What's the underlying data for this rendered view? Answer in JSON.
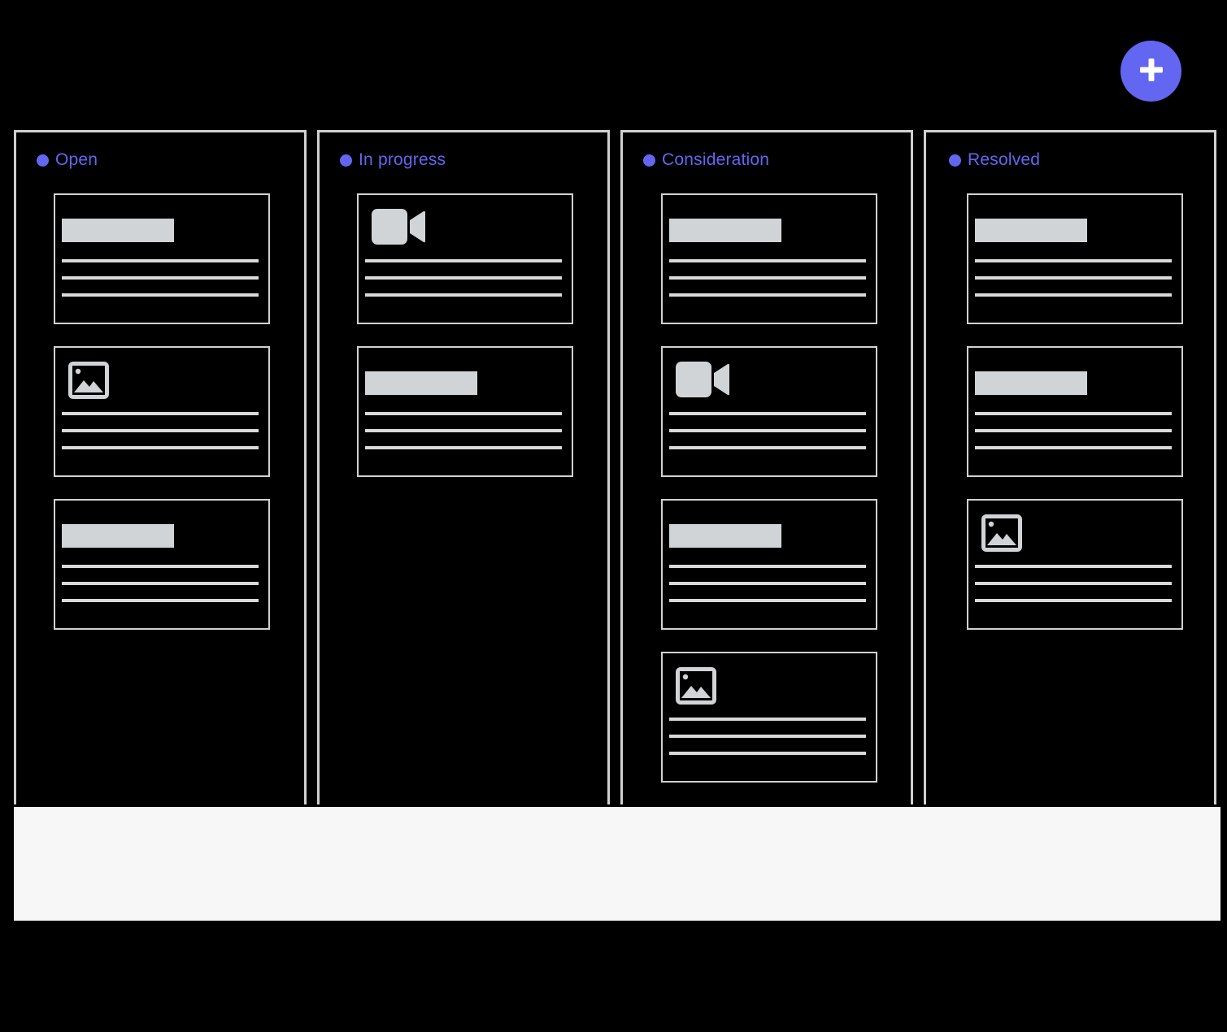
{
  "theme": {
    "accent": "#6366f1",
    "background": "#000000",
    "border": "#d0d0d0",
    "placeholder": "#d1d4d6",
    "footer": "#f7f7f7"
  },
  "toolbar": {
    "add_icon": "plus-icon"
  },
  "columns": [
    {
      "title": "Open",
      "cards": [
        {
          "media": "text"
        },
        {
          "media": "image-icon"
        },
        {
          "media": "text"
        }
      ]
    },
    {
      "title": "In progress",
      "cards": [
        {
          "media": "video-icon"
        },
        {
          "media": "text"
        }
      ]
    },
    {
      "title": "Consideration",
      "cards": [
        {
          "media": "text"
        },
        {
          "media": "video-icon"
        },
        {
          "media": "text"
        },
        {
          "media": "image-icon"
        }
      ]
    },
    {
      "title": "Resolved",
      "cards": [
        {
          "media": "text"
        },
        {
          "media": "text"
        },
        {
          "media": "image-icon"
        }
      ]
    }
  ]
}
